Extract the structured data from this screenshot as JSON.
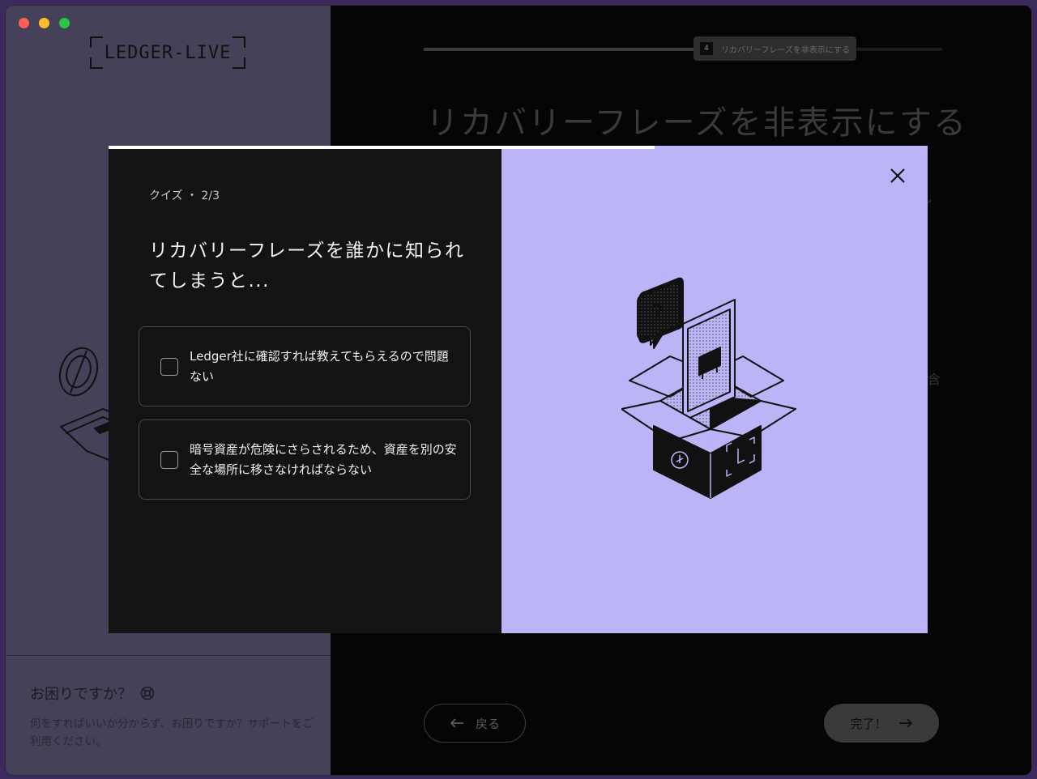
{
  "app": {
    "logo_text": "LEDGER-LIVE"
  },
  "sidebar": {
    "help_title": "お困りですか？",
    "help_text": "何をすればいいか分からず、お困りですか？サポートをご利用ください。"
  },
  "background_page": {
    "step_number": "4",
    "step_label": "リカバリーフレーズを非表示にする",
    "title": "リカバリーフレーズを非表示にする",
    "peek_char_1": "し",
    "peek_char_2": "含",
    "back_label": "戻る",
    "done_label": "完了！"
  },
  "modal": {
    "progress_fraction": 0.667,
    "quiz_label": "クイズ ・ 2/3",
    "question": "リカバリーフレーズを誰かに知られてしまうと...",
    "options": [
      {
        "label": "Ledger社に確認すれば教えてもらえるので問題ない",
        "checked": false
      },
      {
        "label": "暗号資産が危険にさらされるため、資産を別の安全な場所に移さなければならない",
        "checked": false
      }
    ]
  },
  "colors": {
    "modal_accent": "#bbb4f7",
    "sidebar_bg": "#454159",
    "modal_dark": "#131314"
  }
}
